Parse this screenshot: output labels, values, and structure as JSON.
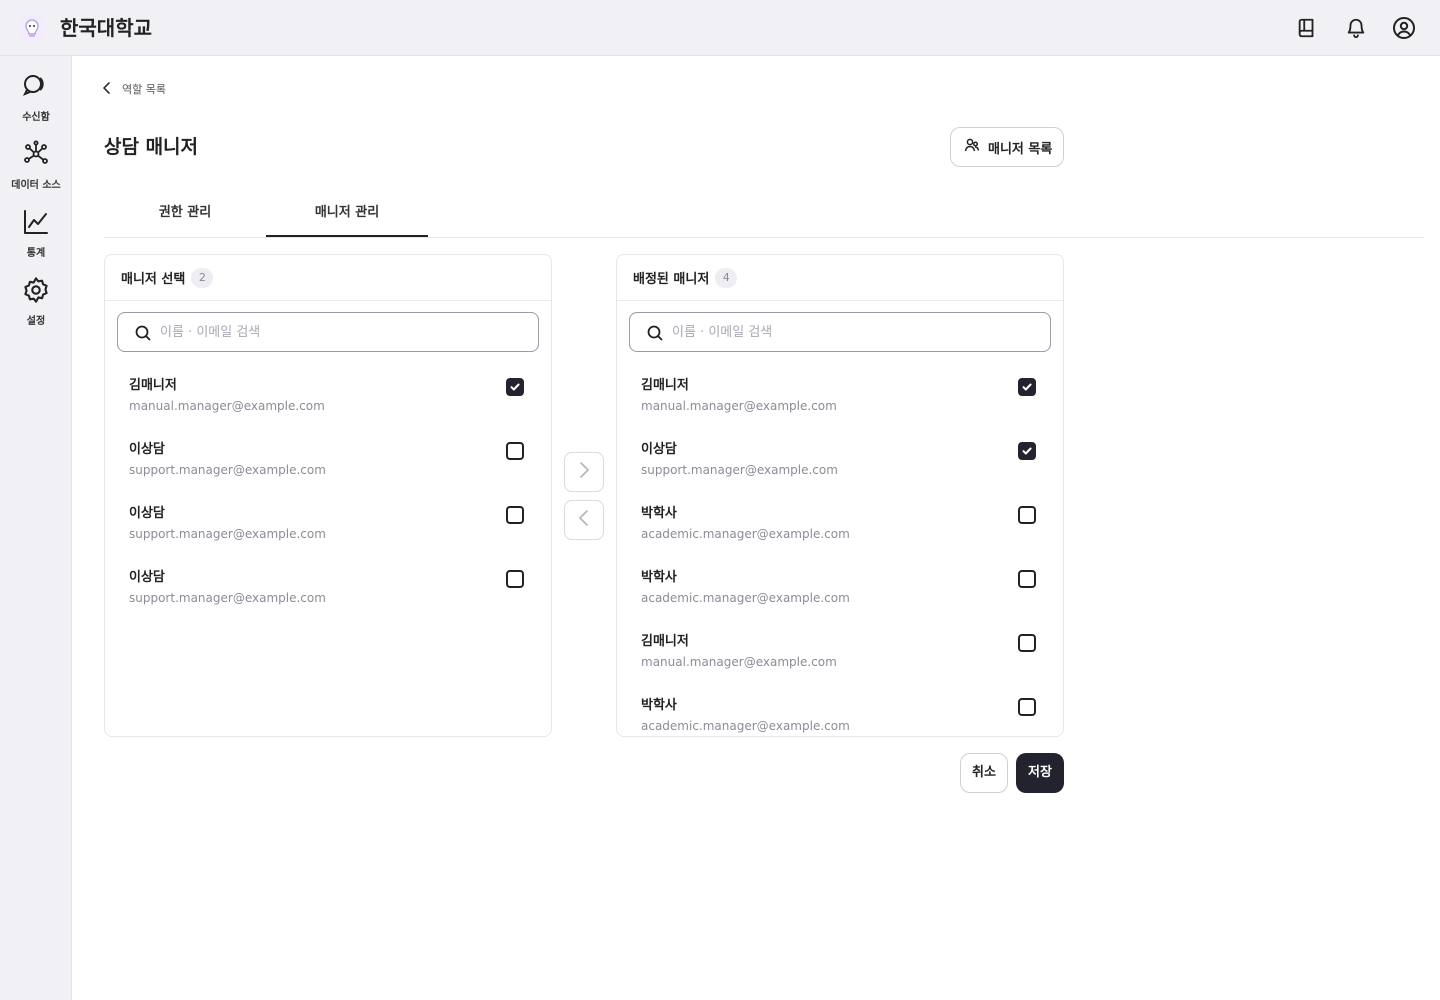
{
  "app": {
    "title": "한국대학교"
  },
  "header": {
    "icons": [
      "book-icon",
      "bell-icon",
      "user-icon"
    ]
  },
  "sidebar": {
    "items": [
      {
        "label": "수신함",
        "icon": "chat-bubbles-icon"
      },
      {
        "label": "데이터 소스",
        "icon": "network-icon"
      },
      {
        "label": "통계",
        "icon": "line-chart-icon"
      },
      {
        "label": "설정",
        "icon": "gear-icon"
      }
    ]
  },
  "breadcrumb": {
    "back_label": "역할 목록"
  },
  "page": {
    "title": "상담 매니저",
    "manager_list_button": "매니저 목록"
  },
  "tabs": [
    {
      "label": "권한 관리",
      "active": false
    },
    {
      "label": "매니저 관리",
      "active": true
    }
  ],
  "left_panel": {
    "title": "매니저 선택",
    "count": "2",
    "search_placeholder": "이름 · 이메일 검색",
    "rows": [
      {
        "name": "김매니저",
        "email": "manual.manager@example.com",
        "checked": true
      },
      {
        "name": "이상담",
        "email": "support.manager@example.com",
        "checked": false
      },
      {
        "name": "이상담",
        "email": "support.manager@example.com",
        "checked": false
      },
      {
        "name": "이상담",
        "email": "support.manager@example.com",
        "checked": false
      }
    ]
  },
  "right_panel": {
    "title": "배정된 매니저",
    "count": "4",
    "search_placeholder": "이름 · 이메일 검색",
    "rows": [
      {
        "name": "김매니저",
        "email": "manual.manager@example.com",
        "checked": true
      },
      {
        "name": "이상담",
        "email": "support.manager@example.com",
        "checked": true
      },
      {
        "name": "박학사",
        "email": "academic.manager@example.com",
        "checked": false
      },
      {
        "name": "박학사",
        "email": "academic.manager@example.com",
        "checked": false
      },
      {
        "name": "김매니저",
        "email": "manual.manager@example.com",
        "checked": false
      },
      {
        "name": "박학사",
        "email": "academic.manager@example.com",
        "checked": false
      }
    ]
  },
  "actions": {
    "cancel_label": "취소",
    "save_label": "저장"
  },
  "colors": {
    "primary": "#232330",
    "sidebar_bg": "#f1f1f5",
    "muted_text": "#8c8c98"
  }
}
